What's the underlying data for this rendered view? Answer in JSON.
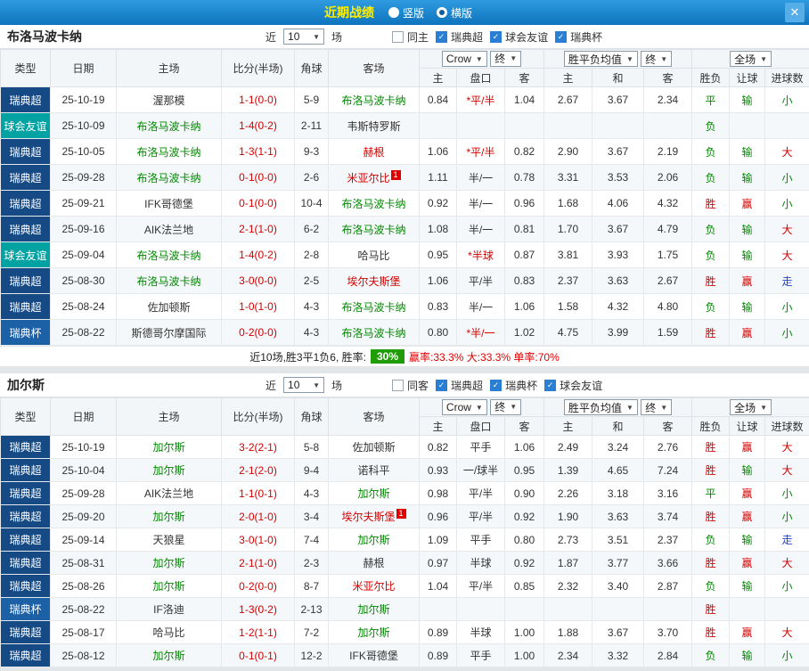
{
  "titlebar": {
    "title": "近期战绩",
    "radios": [
      {
        "label": "竖版",
        "selected": false
      },
      {
        "label": "横版",
        "selected": true
      }
    ],
    "close": "✕"
  },
  "filter_labels": {
    "near": "近",
    "matches": "场"
  },
  "table_header": {
    "col_type": "类型",
    "col_date": "日期",
    "col_home": "主场",
    "col_score": "比分(半场)",
    "col_corner": "角球",
    "col_away": "客场",
    "odds_group": {
      "book": "Crow",
      "final": "终",
      "sub": [
        "主",
        "盘口",
        "客"
      ]
    },
    "europe_group": {
      "book": "胜平负均值",
      "final": "终",
      "sub": [
        "主",
        "和",
        "客"
      ]
    },
    "full_group": {
      "label": "全场",
      "sub": [
        "胜负",
        "让球",
        "进球数"
      ]
    }
  },
  "palette": {
    "type_colors": {
      "瑞典超": "#164a85",
      "球会友谊": "#00a2a2",
      "瑞典杯": "#1c60a6"
    },
    "team_colors": {
      "green": "#008800",
      "black": "#333333",
      "red": "#d40000"
    },
    "result_colors": {
      "胜": "#d40000",
      "平": "#008800",
      "负": "#008800",
      "赢": "#d40000",
      "输": "#008800",
      "走": "#2244cc",
      "大": "#d40000",
      "小": "#008800"
    },
    "score_color": "#d40000",
    "handicap_star_color": "#d40000"
  },
  "sections": [
    {
      "team": "布洛马波卡纳",
      "filters": {
        "count": "10",
        "same": {
          "label": "同主",
          "checked": false
        },
        "comps": [
          {
            "label": "瑞典超",
            "checked": true
          },
          {
            "label": "球会友谊",
            "checked": true
          },
          {
            "label": "瑞典杯",
            "checked": true
          }
        ]
      },
      "rows": [
        {
          "type": "瑞典超",
          "date": "25-10-19",
          "home": "渥那模",
          "home_c": "black",
          "score": "1-1(0-0)",
          "corner": "5-9",
          "away": "布洛马波卡纳",
          "away_c": "green",
          "o1": "0.84",
          "hcap": "*平/半",
          "o2": "1.04",
          "e1": "2.67",
          "e2": "3.67",
          "e3": "2.34",
          "res": "平",
          "asian": "输",
          "goals": "小"
        },
        {
          "type": "球会友谊",
          "date": "25-10-09",
          "home": "布洛马波卡纳",
          "home_c": "green",
          "score": "1-4(0-2)",
          "corner": "2-11",
          "away": "韦斯特罗斯",
          "away_c": "black",
          "o1": "",
          "hcap": "",
          "o2": "",
          "e1": "",
          "e2": "",
          "e3": "",
          "res": "负",
          "asian": "",
          "goals": ""
        },
        {
          "type": "瑞典超",
          "date": "25-10-05",
          "home": "布洛马波卡纳",
          "home_c": "green",
          "score": "1-3(1-1)",
          "corner": "9-3",
          "away": "赫根",
          "away_c": "red",
          "o1": "1.06",
          "hcap": "*平/半",
          "o2": "0.82",
          "e1": "2.90",
          "e2": "3.67",
          "e3": "2.19",
          "res": "负",
          "asian": "输",
          "goals": "大"
        },
        {
          "type": "瑞典超",
          "date": "25-09-28",
          "home": "布洛马波卡纳",
          "home_c": "green",
          "score": "0-1(0-0)",
          "corner": "2-6",
          "away": "米亚尔比",
          "away_c": "red",
          "away_badge": "1",
          "o1": "1.11",
          "hcap": "半/一",
          "o2": "0.78",
          "e1": "3.31",
          "e2": "3.53",
          "e3": "2.06",
          "res": "负",
          "asian": "输",
          "goals": "小"
        },
        {
          "type": "瑞典超",
          "date": "25-09-21",
          "home": "IFK哥德堡",
          "home_c": "black",
          "score": "0-1(0-0)",
          "corner": "10-4",
          "away": "布洛马波卡纳",
          "away_c": "green",
          "o1": "0.92",
          "hcap": "半/一",
          "o2": "0.96",
          "e1": "1.68",
          "e2": "4.06",
          "e3": "4.32",
          "res": "胜",
          "asian": "赢",
          "goals": "小"
        },
        {
          "type": "瑞典超",
          "date": "25-09-16",
          "home": "AIK法兰地",
          "home_c": "black",
          "score": "2-1(1-0)",
          "corner": "6-2",
          "away": "布洛马波卡纳",
          "away_c": "green",
          "o1": "1.08",
          "hcap": "半/一",
          "o2": "0.81",
          "e1": "1.70",
          "e2": "3.67",
          "e3": "4.79",
          "res": "负",
          "asian": "输",
          "goals": "大"
        },
        {
          "type": "球会友谊",
          "date": "25-09-04",
          "home": "布洛马波卡纳",
          "home_c": "green",
          "score": "1-4(0-2)",
          "corner": "2-8",
          "away": "哈马比",
          "away_c": "black",
          "o1": "0.95",
          "hcap": "*半球",
          "o2": "0.87",
          "e1": "3.81",
          "e2": "3.93",
          "e3": "1.75",
          "res": "负",
          "asian": "输",
          "goals": "大"
        },
        {
          "type": "瑞典超",
          "date": "25-08-30",
          "home": "布洛马波卡纳",
          "home_c": "green",
          "score": "3-0(0-0)",
          "corner": "2-5",
          "away": "埃尔夫斯堡",
          "away_c": "red",
          "o1": "1.06",
          "hcap": "平/半",
          "o2": "0.83",
          "e1": "2.37",
          "e2": "3.63",
          "e3": "2.67",
          "res": "胜",
          "asian": "赢",
          "goals": "走"
        },
        {
          "type": "瑞典超",
          "date": "25-08-24",
          "home": "佐加顿斯",
          "home_c": "black",
          "score": "1-0(1-0)",
          "corner": "4-3",
          "away": "布洛马波卡纳",
          "away_c": "green",
          "o1": "0.83",
          "hcap": "半/一",
          "o2": "1.06",
          "e1": "1.58",
          "e2": "4.32",
          "e3": "4.80",
          "res": "负",
          "asian": "输",
          "goals": "小"
        },
        {
          "type": "瑞典杯",
          "date": "25-08-22",
          "home": "斯德哥尔摩国际",
          "home_c": "black",
          "score": "0-2(0-0)",
          "corner": "4-3",
          "away": "布洛马波卡纳",
          "away_c": "green",
          "o1": "0.80",
          "hcap": "*半/一",
          "o2": "1.02",
          "e1": "4.75",
          "e2": "3.99",
          "e3": "1.59",
          "res": "胜",
          "asian": "赢",
          "goals": "小"
        }
      ],
      "summary": {
        "text": "近10场,胜3平1负6, 胜率:",
        "rate": "30%",
        "tail": "赢率:33.3% 大:33.3% 单率:70%"
      }
    },
    {
      "team": "加尔斯",
      "filters": {
        "count": "10",
        "same": {
          "label": "同客",
          "checked": false
        },
        "comps": [
          {
            "label": "瑞典超",
            "checked": true
          },
          {
            "label": "瑞典杯",
            "checked": true
          },
          {
            "label": "球会友谊",
            "checked": true
          }
        ]
      },
      "rows": [
        {
          "type": "瑞典超",
          "date": "25-10-19",
          "home": "加尔斯",
          "home_c": "green",
          "score": "3-2(2-1)",
          "corner": "5-8",
          "away": "佐加顿斯",
          "away_c": "black",
          "o1": "0.82",
          "hcap": "平手",
          "o2": "1.06",
          "e1": "2.49",
          "e2": "3.24",
          "e3": "2.76",
          "res": "胜",
          "asian": "赢",
          "goals": "大"
        },
        {
          "type": "瑞典超",
          "date": "25-10-04",
          "home": "加尔斯",
          "home_c": "green",
          "score": "2-1(2-0)",
          "corner": "9-4",
          "away": "诺科平",
          "away_c": "black",
          "o1": "0.93",
          "hcap": "一/球半",
          "o2": "0.95",
          "e1": "1.39",
          "e2": "4.65",
          "e3": "7.24",
          "res": "胜",
          "asian": "输",
          "goals": "大"
        },
        {
          "type": "瑞典超",
          "date": "25-09-28",
          "home": "AIK法兰地",
          "home_c": "black",
          "score": "1-1(0-1)",
          "corner": "4-3",
          "away": "加尔斯",
          "away_c": "green",
          "o1": "0.98",
          "hcap": "平/半",
          "o2": "0.90",
          "e1": "2.26",
          "e2": "3.18",
          "e3": "3.16",
          "res": "平",
          "asian": "赢",
          "goals": "小"
        },
        {
          "type": "瑞典超",
          "date": "25-09-20",
          "home": "加尔斯",
          "home_c": "green",
          "score": "2-0(1-0)",
          "corner": "3-4",
          "away": "埃尔夫斯堡",
          "away_c": "red",
          "away_badge": "1",
          "o1": "0.96",
          "hcap": "平/半",
          "o2": "0.92",
          "e1": "1.90",
          "e2": "3.63",
          "e3": "3.74",
          "res": "胜",
          "asian": "赢",
          "goals": "小"
        },
        {
          "type": "瑞典超",
          "date": "25-09-14",
          "home": "天狼星",
          "home_c": "black",
          "score": "3-0(1-0)",
          "corner": "7-4",
          "away": "加尔斯",
          "away_c": "green",
          "o1": "1.09",
          "hcap": "平手",
          "o2": "0.80",
          "e1": "2.73",
          "e2": "3.51",
          "e3": "2.37",
          "res": "负",
          "asian": "输",
          "goals": "走"
        },
        {
          "type": "瑞典超",
          "date": "25-08-31",
          "home": "加尔斯",
          "home_c": "green",
          "score": "2-1(1-0)",
          "corner": "2-3",
          "away": "赫根",
          "away_c": "black",
          "o1": "0.97",
          "hcap": "半球",
          "o2": "0.92",
          "e1": "1.87",
          "e2": "3.77",
          "e3": "3.66",
          "res": "胜",
          "asian": "赢",
          "goals": "大"
        },
        {
          "type": "瑞典超",
          "date": "25-08-26",
          "home": "加尔斯",
          "home_c": "green",
          "score": "0-2(0-0)",
          "corner": "8-7",
          "away": "米亚尔比",
          "away_c": "red",
          "o1": "1.04",
          "hcap": "平/半",
          "o2": "0.85",
          "e1": "2.32",
          "e2": "3.40",
          "e3": "2.87",
          "res": "负",
          "asian": "输",
          "goals": "小"
        },
        {
          "type": "瑞典杯",
          "date": "25-08-22",
          "home": "IF洛迪",
          "home_c": "black",
          "score": "1-3(0-2)",
          "corner": "2-13",
          "away": "加尔斯",
          "away_c": "green",
          "o1": "",
          "hcap": "",
          "o2": "",
          "e1": "",
          "e2": "",
          "e3": "",
          "res": "胜",
          "asian": "",
          "goals": ""
        },
        {
          "type": "瑞典超",
          "date": "25-08-17",
          "home": "哈马比",
          "home_c": "black",
          "score": "1-2(1-1)",
          "corner": "7-2",
          "away": "加尔斯",
          "away_c": "green",
          "o1": "0.89",
          "hcap": "半球",
          "o2": "1.00",
          "e1": "1.88",
          "e2": "3.67",
          "e3": "3.70",
          "res": "胜",
          "asian": "赢",
          "goals": "大"
        },
        {
          "type": "瑞典超",
          "date": "25-08-12",
          "home": "加尔斯",
          "home_c": "green",
          "score": "0-1(0-1)",
          "corner": "12-2",
          "away": "IFK哥德堡",
          "away_c": "black",
          "o1": "0.89",
          "hcap": "平手",
          "o2": "1.00",
          "e1": "2.34",
          "e2": "3.32",
          "e3": "2.84",
          "res": "负",
          "asian": "输",
          "goals": "小"
        }
      ]
    }
  ]
}
